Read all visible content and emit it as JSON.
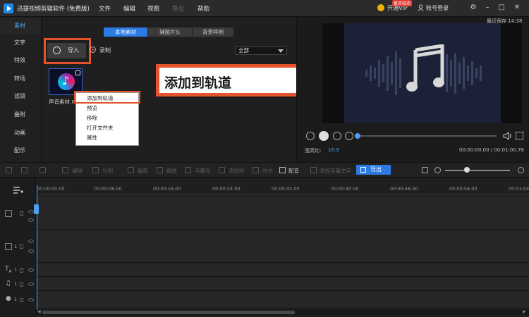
{
  "titlebar": {
    "app_title": "迅捷视频剪辑软件 (免费版)",
    "menus": [
      "文件",
      "编辑",
      "视图",
      "导出",
      "帮助"
    ],
    "vip_label": "开通VIP",
    "vip_badge": "复旦狂欢",
    "login_label": "账号登录"
  },
  "sidebar": {
    "items": [
      {
        "label": "素材",
        "active": true
      },
      {
        "label": "文字"
      },
      {
        "label": "特效"
      },
      {
        "label": "转场"
      },
      {
        "label": "滤镜"
      },
      {
        "label": "叠附"
      },
      {
        "label": "动画"
      },
      {
        "label": "配乐"
      }
    ]
  },
  "media": {
    "tabs": [
      "本地素材",
      "辅菌片头",
      "背景样例"
    ],
    "active_tab": 0,
    "import_label": "导入",
    "record_label": "录制",
    "filter_value": "全部",
    "item_label": "声音素材.m",
    "context_menu": [
      "添加到轨道",
      "预览",
      "移除",
      "打开文件夹",
      "属性"
    ],
    "callout_text": "添加到轨道"
  },
  "preview": {
    "save_status": "最近保存 14:38",
    "ratio_label": "宽高比:",
    "ratio_value": "16:9",
    "time": "00:00:00.00 / 00:01:00.76"
  },
  "toolbar": {
    "items": [
      "编辑",
      "分割",
      "裁剪",
      "缩放",
      "马赛克",
      "添加帧",
      "时长",
      "配音",
      "添加字幕文字"
    ],
    "export_label": "导出"
  },
  "timeline": {
    "ticks": [
      "00:00:00.00",
      "00:00:08.00",
      "00:00:16.00",
      "00:00:24.00",
      "00:00:32.00",
      "00:00:40.00",
      "00:00:48.00",
      "00:00:56.00",
      "00:01:04.00"
    ],
    "track_numbers": [
      "1",
      "1",
      "1",
      "1"
    ]
  },
  "colors": {
    "accent": "#2c7be5",
    "highlight": "#e5532a",
    "background": "#1b1b1b"
  }
}
